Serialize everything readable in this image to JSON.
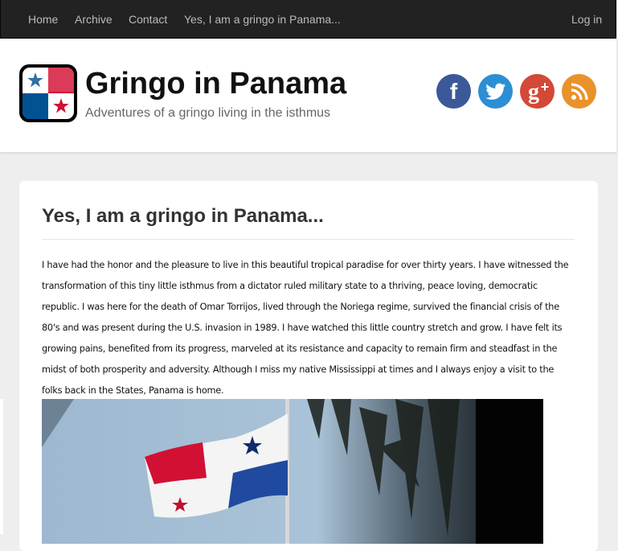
{
  "nav": {
    "items": [
      {
        "label": "Home"
      },
      {
        "label": "Archive"
      },
      {
        "label": "Contact"
      },
      {
        "label": "Yes, I am a gringo in Panama..."
      }
    ],
    "login_label": "Log in"
  },
  "header": {
    "title": "Gringo in Panama",
    "tagline": "Adventures of a gringo living in the isthmus",
    "social": [
      {
        "name": "facebook-icon",
        "glyph": "f",
        "color": "#3b5998"
      },
      {
        "name": "twitter-icon",
        "glyph": "t",
        "color": "#2c8fd4"
      },
      {
        "name": "google-plus-icon",
        "glyph": "g+",
        "color": "#d34836"
      },
      {
        "name": "rss-icon",
        "glyph": "rss",
        "color": "#e8922c"
      }
    ]
  },
  "post": {
    "title": "Yes, I am a gringo in Panama...",
    "body": "I have had the honor and the pleasure to live in this beautiful tropical paradise for over thirty years.  I have witnessed the transformation of this tiny little isthmus from a dictator ruled military state to a thriving, peace loving, democratic republic. I was here for the death of Omar Torrijos, lived through the Noriega regime,  survived the financial crisis of the 80's and was present during the U.S. invasion in 1989.   I have watched this little country stretch and grow. I have felt its growing pains, benefited from its progress,  marveled at its resistance and capacity to remain firm and steadfast in the midst of both prosperity and adversity.  Although I miss my native Mississippi at times and I always enjoy a visit to the folks back in the States, Panama is home."
  },
  "colors": {
    "nav_bg": "#222222",
    "flag_red": "#d21034",
    "flag_blue": "#005293"
  }
}
